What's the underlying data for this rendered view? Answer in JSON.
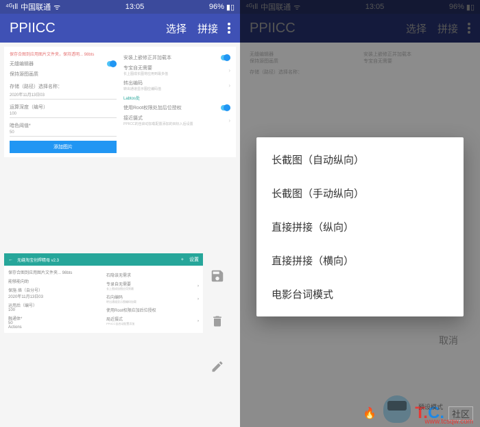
{
  "status": {
    "carrier": "中国联通",
    "time": "13:05",
    "battery": "96%"
  },
  "appbar": {
    "title": "PPIICC",
    "select": "选择",
    "stitch": "拼接"
  },
  "left_preview": {
    "red_line": "保存合图到应用图片文件夹，保持透明... 98bts",
    "l": [
      {
        "t": "无缝编辑器"
      },
      {
        "t": "保持源图画质"
      },
      {
        "t": "存储（路径）选择名称：",
        "v": "2020年11月13日03"
      },
      {
        "t": "运算深度（编号）",
        "v": "100"
      },
      {
        "t": "暗色阈值*",
        "v": "50"
      }
    ],
    "r": [
      {
        "t": "安装上嵌修正并加载本"
      },
      {
        "t": "专宝自无需要",
        "s": "长上图成长图将应用到最多值"
      },
      {
        "t": "转出编码",
        "s": "转出通道显示图应编码值"
      },
      {
        "t": "Labtos处",
        "teal": true
      },
      {
        "t": "使用Root权限处加后位授权"
      },
      {
        "t": "接近摄式",
        "s": "PPIICC的自启动加载配置添加的目标入后设置"
      }
    ],
    "btn": "添加图片"
  },
  "card2": {
    "title": "无缝淘宝创焊精母 v2.3",
    "act1": "+",
    "act2": "设置",
    "red": "保存合图到应用图片文件夹... 98bts",
    "l": [
      {
        "t": "能够能向助"
      },
      {
        "t": "保施·烙（自分号）",
        "v": "2020年11月13日03"
      },
      {
        "t": "运用后（编号）",
        "v": "100"
      },
      {
        "t": "融通体*",
        "v": "50"
      }
    ],
    "r": [
      {
        "t": "石隐该无需求"
      },
      {
        "t": "专录自无需要",
        "s": "长上图成加图应用到最"
      },
      {
        "t": "右向编码",
        "s": "转出通道显示图编码加载"
      },
      {
        "t": "使用Root权限应加后位授权"
      },
      {
        "t": "局近摄式",
        "s": "PPIICC自启动配置添加"
      }
    ],
    "btn": "Actions"
  },
  "menu": {
    "items": [
      "长截图（自动纵向）",
      "长截图（手动纵向）",
      "直接拼接（纵向）",
      "直接拼接（横向）",
      "电影台词模式"
    ],
    "cancel": "取消"
  },
  "watermark": {
    "preview": "预设模式",
    "community": "社区",
    "url": "www.tcsqw.com"
  }
}
